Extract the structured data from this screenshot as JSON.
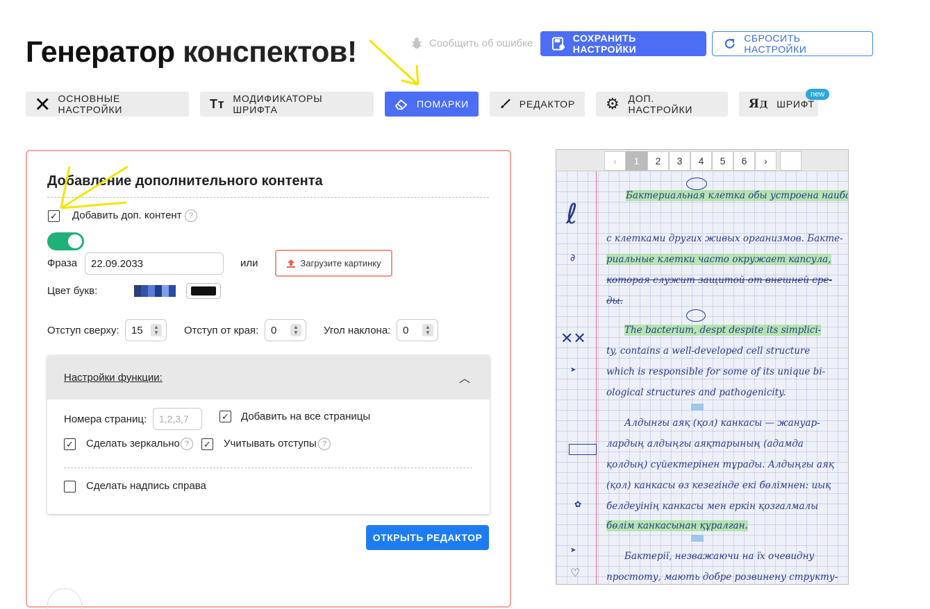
{
  "header": {
    "title_bold": "Генератор",
    "title_rest": "конспектов!",
    "report_link": "Сообщить об ошибке",
    "save_label": "СОХРАНИТЬ НАСТРОЙКИ",
    "reset_label": "СБРОСИТЬ НАСТРОЙКИ"
  },
  "tabs": [
    {
      "label": "ОСНОВНЫЕ НАСТРОЙКИ",
      "icon": "tools-icon"
    },
    {
      "label": "МОДИФИКАТОРЫ ШРИФТА",
      "icon": "font-size-icon"
    },
    {
      "label": "ПОМАРКИ",
      "icon": "eraser-icon",
      "active": true
    },
    {
      "label": "РЕДАКТОР",
      "icon": "brush-icon"
    },
    {
      "label": "ДОП. НАСТРОЙКИ",
      "icon": "gear-icon"
    },
    {
      "label": "ШРИФТ",
      "icon": "font-icon",
      "badge": "new"
    }
  ],
  "content": {
    "section_title": "Добавление дополнительного контента",
    "add_content_label": "Добавить доп. контент",
    "add_content_checked": true,
    "toggle_on": true,
    "phrase_label": "Фраза",
    "phrase_value": "22.09.2033",
    "or_label": "или",
    "upload_label": "Загрузите картинку",
    "color_label": "Цвет букв:",
    "letter_color": "#111111",
    "offset_top_label": "Отступ сверху:",
    "offset_top_value": "15",
    "offset_edge_label": "Отступ от края:",
    "offset_edge_value": "0",
    "angle_label": "Угол наклона:",
    "angle_value": "0",
    "func": {
      "title": "Настройки функции:",
      "pages_label": "Номера страниц:",
      "pages_placeholder": "1,2,3,7",
      "all_pages_label": "Добавить на все страницы",
      "mirror_label": "Сделать зеркально",
      "offsets_label": "Учитывать отступы",
      "right_label": "Сделать надпись справа"
    },
    "open_editor_label": "ОТКРЫТЬ РЕДАКТОР"
  },
  "preview": {
    "pages": [
      "1",
      "2",
      "3",
      "4",
      "5",
      "6"
    ],
    "prev": "‹",
    "next": "›",
    "lines": [
      "Бактериальная клетка обы устроена наиболее просто по сравнению",
      "с клетками других живых организмов. Бакте-",
      "риальные клетки часто окружает капсула,",
      "которая служит защитой от внешней сре-",
      "ды.",
      "The bacterium, despt despite its simplici-",
      "ty, contains a well-developed cell structure",
      "which is responsible for some of its unique bi-",
      "ological structures and pathogenicity.",
      "Алдынгы аяқ (қол) канкасы — жануар-",
      "лардың алдыңгы аяқтарының (адамда",
      "қолдың) сүйектерінен тұрады. Алдыңгы аяқ",
      "(қол) канкасы өз кезегінде екі бөлімнен: иық",
      "белдеуінің канкасы мен еркін қозгалмалы",
      "бөлім канкасынан құралган.",
      "Бактерії, незважаючи на їх очевидну",
      "простоту, мають добре розвинену структу-"
    ]
  },
  "colors": {
    "accent": "#4c6ef5",
    "toggle": "#20b07a",
    "card_border": "#f2a49a",
    "open_editor": "#1e7cf2"
  }
}
